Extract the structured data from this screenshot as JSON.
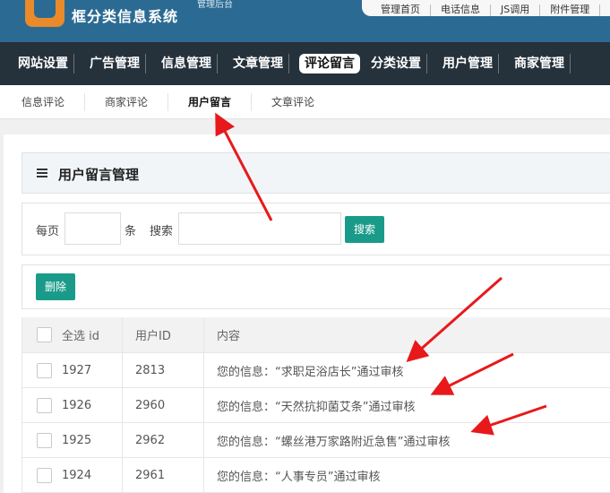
{
  "brand": {
    "title": "框分类信息系统",
    "subtitle": "管理后台"
  },
  "quick_links": [
    "管理首页",
    "电话信息",
    "JS调用",
    "附件管理"
  ],
  "nav": [
    "网站设置",
    "广告管理",
    "信息管理",
    "文章管理",
    "评论留言",
    "分类设置",
    "用户管理",
    "商家管理"
  ],
  "nav_active": 4,
  "subnav": [
    "信息评论",
    "商家评论",
    "用户留言",
    "文章评论"
  ],
  "subnav_active": 2,
  "page_title": "用户留言管理",
  "search": {
    "per_page_label": "每页",
    "unit": "条",
    "search_label": "搜索",
    "per_page_value": "",
    "keyword_value": "",
    "button": "搜索"
  },
  "actions": {
    "delete": "删除"
  },
  "table": {
    "headers": {
      "select_all": "全选 id",
      "user_id": "用户ID",
      "content": "内容"
    },
    "rows": [
      {
        "id": "1927",
        "user_id": "2813",
        "content": "您的信息：“求职足浴店长”通过审核"
      },
      {
        "id": "1926",
        "user_id": "2960",
        "content": "您的信息：“天然抗抑菌艾条”通过审核"
      },
      {
        "id": "1925",
        "user_id": "2962",
        "content": "您的信息：“螺丝港万家路附近急售”通过审核"
      },
      {
        "id": "1924",
        "user_id": "2961",
        "content": "您的信息：“人事专员”通过审核"
      }
    ]
  },
  "colors": {
    "header_bg": "#2b6b93",
    "nav_bg": "#25313b",
    "accent": "#1a9b8a",
    "logo": "#e98a2b",
    "annotation": "#e8191b"
  }
}
